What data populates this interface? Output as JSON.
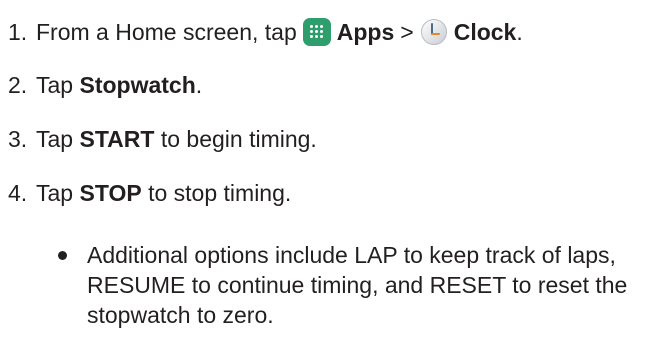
{
  "steps": [
    {
      "number": "1.",
      "prefix": "From a Home screen, tap",
      "apps_label": "Apps",
      "separator": ">",
      "clock_label": "Clock",
      "suffix": "."
    },
    {
      "number": "2.",
      "prefix": "Tap",
      "bold": "Stopwatch",
      "suffix": "."
    },
    {
      "number": "3.",
      "prefix": "Tap",
      "bold": "START",
      "suffix": "to begin timing."
    },
    {
      "number": "4.",
      "prefix": "Tap",
      "bold": "STOP",
      "suffix": "to stop timing."
    }
  ],
  "bullet": {
    "text": "Additional options include LAP to keep track of laps, RESUME to continue timing, and RESET to reset the stopwatch to zero."
  },
  "icons": {
    "apps": "apps-grid-icon",
    "clock": "clock-icon"
  },
  "colors": {
    "text": "#231f20",
    "apps_icon_bg": "#2e9e6c"
  }
}
